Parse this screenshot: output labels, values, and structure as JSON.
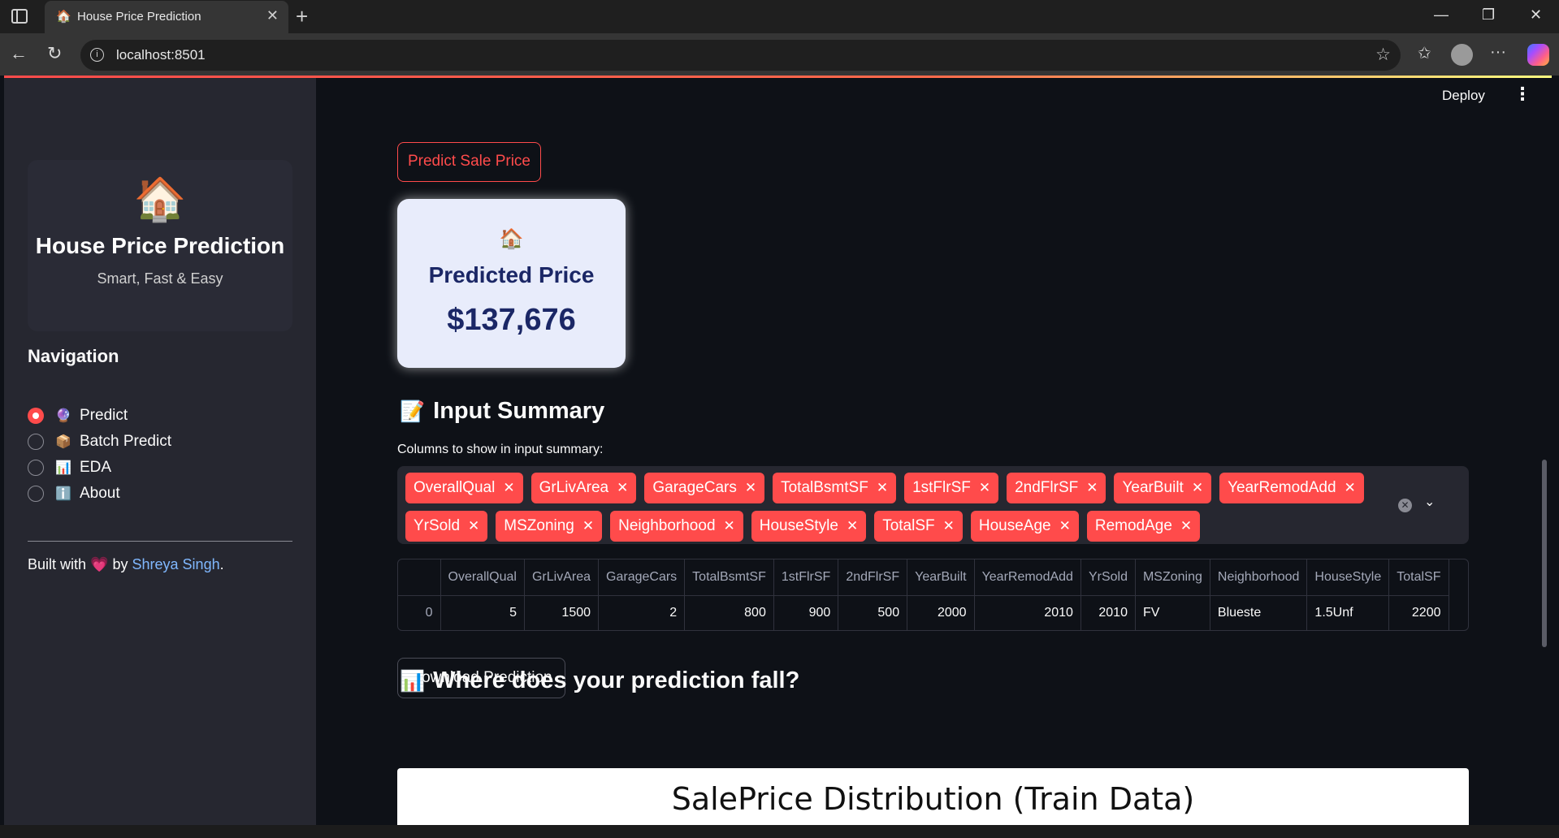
{
  "browser": {
    "tab_title": "House Price Prediction",
    "tab_favicon": "🏠",
    "url": "localhost:8501"
  },
  "sidebar": {
    "brand_icon": "🏠",
    "brand_title": "House Price Prediction",
    "brand_subtitle": "Smart, Fast & Easy",
    "nav_heading": "Navigation",
    "nav_items": [
      {
        "emoji": "🔮",
        "label": "Predict",
        "selected": true
      },
      {
        "emoji": "📦",
        "label": "Batch Predict",
        "selected": false
      },
      {
        "emoji": "📊",
        "label": "EDA",
        "selected": false
      },
      {
        "emoji": "ℹ️",
        "label": "About",
        "selected": false
      }
    ],
    "footer": {
      "prefix": "Built with",
      "heart": "💗",
      "by": "by",
      "author": "Shreya Singh",
      "suffix": "."
    }
  },
  "header": {
    "deploy_label": "Deploy",
    "menu_icon": "⋮"
  },
  "main": {
    "predict_button": "Predict Sale Price",
    "price_card": {
      "icon": "🏠",
      "label": "Predicted Price",
      "value": "$137,676"
    },
    "input_summary": {
      "emoji": "📝",
      "heading": "Input Summary",
      "multiselect_label": "Columns to show in input summary:",
      "chips": [
        "OverallQual",
        "GrLivArea",
        "GarageCars",
        "TotalBsmtSF",
        "1stFlrSF",
        "2ndFlrSF",
        "YearBuilt",
        "YearRemodAdd",
        "YrSold",
        "MSZoning",
        "Neighborhood",
        "HouseStyle",
        "TotalSF",
        "HouseAge",
        "RemodAge"
      ]
    },
    "table": {
      "columns": [
        "",
        "OverallQual",
        "GrLivArea",
        "GarageCars",
        "TotalBsmtSF",
        "1stFlrSF",
        "2ndFlrSF",
        "YearBuilt",
        "YearRemodAdd",
        "YrSold",
        "MSZoning",
        "Neighborhood",
        "HouseStyle",
        "TotalSF"
      ],
      "rows": [
        [
          "0",
          "5",
          "1500",
          "2",
          "800",
          "900",
          "500",
          "2000",
          "2010",
          "2010",
          "FV",
          "Blueste",
          "1.5Unf",
          "2200"
        ]
      ]
    },
    "download_button": "Download Prediction",
    "distribution": {
      "emoji": "📊",
      "heading": "Where does your prediction fall?",
      "chart_title": "SalePrice Distribution (Train Data)"
    }
  },
  "colors": {
    "accent": "#ff4b4b",
    "sidebar_bg": "#262730",
    "main_bg": "#0e1117",
    "price_card_bg": "#e8ecfb",
    "price_text": "#1b2766"
  }
}
